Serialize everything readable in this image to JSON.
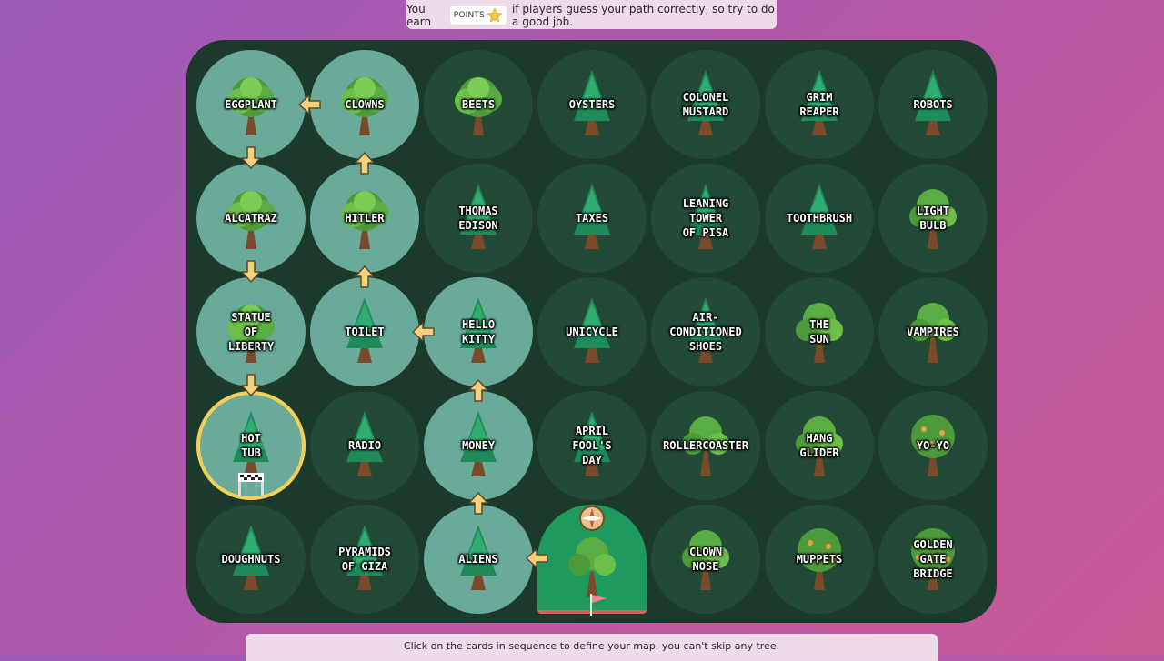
{
  "header": {
    "text_before": "You earn",
    "points_label": "POINTS",
    "text_after": "if players guess your path correctly, so try to do a good job."
  },
  "footer": {
    "instruction": "Click on the cards in sequence to define your map, you can't skip any tree."
  },
  "colors": {
    "board": "#1b3a2c",
    "cell": "#224a37",
    "path_cell": "#6aaa9a",
    "current_ring": "#f5cf55",
    "start_cell": "#1f9a5e",
    "arrow": "#f4cf7c"
  },
  "grid": {
    "rows": [
      [
        "EGGPLANT",
        "CLOWNS",
        "BEETS",
        "OYSTERS",
        "COLONEL\nMUSTARD",
        "GRIM\nREAPER",
        "ROBOTS"
      ],
      [
        "ALCATRAZ",
        "HITLER",
        "THOMAS\nEDISON",
        "TAXES",
        "LEANING\nTOWER\nOF PISA",
        "TOOTHBRUSH",
        "LIGHT\nBULB"
      ],
      [
        "STATUE\nOF\nLIBERTY",
        "TOILET",
        "HELLO\nKITTY",
        "UNICYCLE",
        "AIR-\nCONDITIONED\nSHOES",
        "THE\nSUN",
        "VAMPIRES"
      ],
      [
        "HOT\nTUB",
        "RADIO",
        "MONEY",
        "APRIL\nFOOL'S\nDAY",
        "ROLLERCOASTER",
        "HANG\nGLIDER",
        "YO-YO"
      ],
      [
        "DOUGHNUTS",
        "PYRAMIDS\nOF GIZA",
        "ALIENS",
        "",
        "CLOWN\nNOSE",
        "MUPPETS",
        "GOLDEN\nGATE\nBRIDGE"
      ]
    ]
  }
}
